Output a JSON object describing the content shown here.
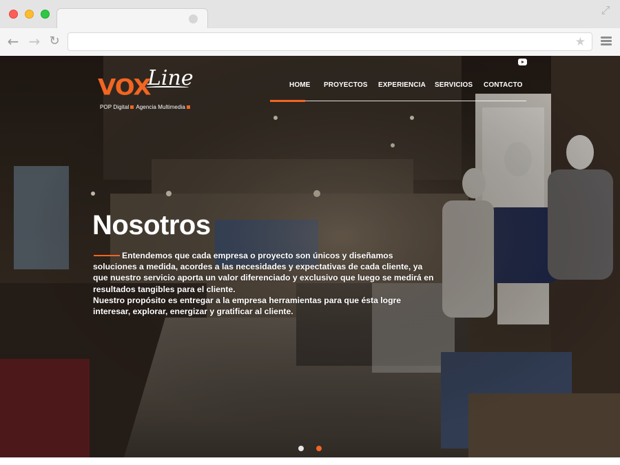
{
  "browser": {
    "address_url": "",
    "icons": [
      "back-arrow-icon",
      "forward-arrow-icon",
      "reload-icon",
      "star-icon",
      "menu-icon",
      "expand-icon"
    ]
  },
  "site": {
    "logo": {
      "word_vox": "VOX",
      "word_line": "Line",
      "tagline_part1": "POP Digital",
      "tagline_part2": "Agencia Multimedia"
    },
    "nav": {
      "items": [
        {
          "label": "HOME",
          "active": true
        },
        {
          "label": "PROYECTOS",
          "active": false
        },
        {
          "label": "EXPERIENCIA",
          "active": false
        },
        {
          "label": "SERVICIOS",
          "active": false
        },
        {
          "label": "CONTACTO",
          "active": false
        }
      ]
    },
    "hero": {
      "title": "Nosotros",
      "paragraph1": "Entendemos que cada empresa o proyecto son únicos y diseñamos soluciones a medida, acordes a las necesidades y expectativas de cada cliente, ya que nuestro servicio aporta un valor diferenciado y exclusivo que luego se medirá en resultados tangibles para el cliente.",
      "paragraph2": "Nuestro propósito es entregar a la empresa herramientas para que ésta logre interesar, explorar, energizar y gratificar al cliente."
    },
    "slider": {
      "dot_count": 2,
      "active_index": 1
    },
    "colors": {
      "accent": "#f26522",
      "text": "#ffffff"
    }
  }
}
